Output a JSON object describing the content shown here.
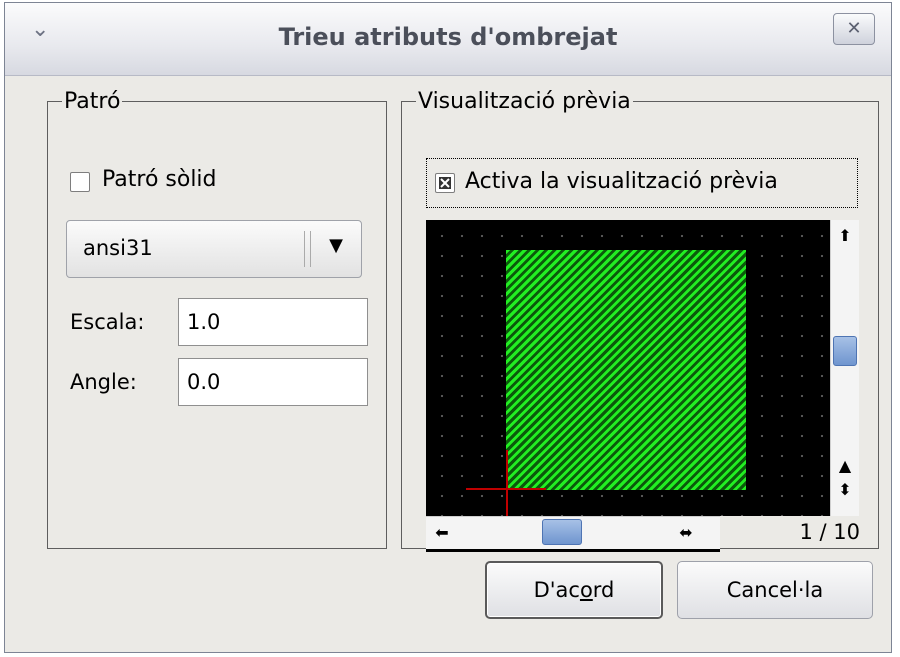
{
  "window": {
    "title": "Trieu atributs d'ombrejat",
    "menu_icon": "chevron-down-icon",
    "close_icon": "close-icon",
    "close_glyph": "✕"
  },
  "pattern": {
    "group_label": "Patró",
    "solid_label": "Patró sòlid",
    "solid_checked": false,
    "combo_value": "ansi31",
    "combo_arrow_glyph": "▼",
    "scale_label": "Escala:",
    "scale_value": "1.0",
    "angle_label": "Angle:",
    "angle_value": "0.0"
  },
  "preview": {
    "group_label": "Visualització prèvia",
    "enable_label": "Activa la visualització prèvia",
    "enable_checked": true,
    "page_indicator": "1 / 10",
    "vscroll": {
      "up_glyph": "⬆",
      "down_glyph": "⬍"
    },
    "hscroll": {
      "left_glyph": "⬅",
      "right_glyph": "⬌"
    },
    "canvas_colors": {
      "background": "#000000",
      "hatch": "#22ee22",
      "crosshair": "#c00000"
    }
  },
  "buttons": {
    "ok_pre": "D'ac",
    "ok_mnemonic": "o",
    "ok_post": "rd",
    "cancel_label": "Cancel·la"
  }
}
